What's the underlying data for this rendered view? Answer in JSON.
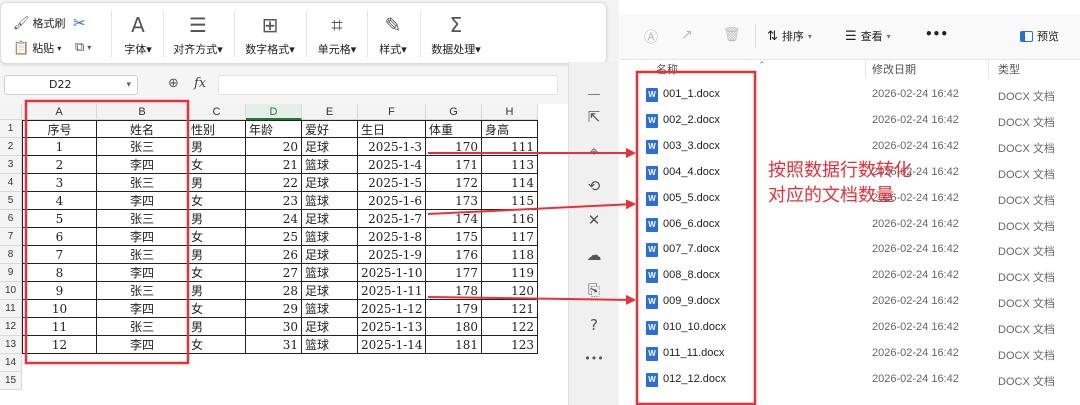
{
  "ribbon": {
    "format_painter": "格式刷",
    "paste": "粘贴",
    "font": "字体",
    "align": "对齐方式",
    "number_format": "数字格式",
    "cell": "单元格",
    "style": "样式",
    "data_process": "数据处理"
  },
  "formula_bar": {
    "name_box": "D22",
    "fx": "fx"
  },
  "sheet": {
    "columns": [
      "A",
      "B",
      "C",
      "D",
      "E",
      "F",
      "G",
      "H"
    ],
    "row_numbers": [
      "1",
      "2",
      "3",
      "4",
      "5",
      "6",
      "7",
      "8",
      "9",
      "10",
      "11",
      "12",
      "13",
      "14",
      "15"
    ],
    "headers": [
      "序号",
      "姓名",
      "性别",
      "年龄",
      "爱好",
      "生日",
      "体重",
      "身高"
    ],
    "rows": [
      [
        "1",
        "张三",
        "男",
        "20",
        "足球",
        "2025-1-3",
        "170",
        "111"
      ],
      [
        "2",
        "李四",
        "女",
        "21",
        "篮球",
        "2025-1-4",
        "171",
        "113"
      ],
      [
        "3",
        "张三",
        "男",
        "22",
        "足球",
        "2025-1-5",
        "172",
        "114"
      ],
      [
        "4",
        "李四",
        "女",
        "23",
        "篮球",
        "2025-1-6",
        "173",
        "115"
      ],
      [
        "5",
        "张三",
        "男",
        "24",
        "足球",
        "2025-1-7",
        "174",
        "116"
      ],
      [
        "6",
        "李四",
        "女",
        "25",
        "篮球",
        "2025-1-8",
        "175",
        "117"
      ],
      [
        "7",
        "张三",
        "男",
        "26",
        "足球",
        "2025-1-9",
        "176",
        "118"
      ],
      [
        "8",
        "李四",
        "女",
        "27",
        "篮球",
        "2025-1-10",
        "177",
        "119"
      ],
      [
        "9",
        "张三",
        "男",
        "28",
        "足球",
        "2025-1-11",
        "178",
        "120"
      ],
      [
        "10",
        "李四",
        "女",
        "29",
        "篮球",
        "2025-1-12",
        "179",
        "121"
      ],
      [
        "11",
        "张三",
        "男",
        "30",
        "足球",
        "2025-1-13",
        "180",
        "122"
      ],
      [
        "12",
        "李四",
        "女",
        "31",
        "篮球",
        "2025-1-14",
        "181",
        "123"
      ]
    ]
  },
  "explorer": {
    "toolbar": {
      "sort": "排序",
      "view": "查看",
      "more": "•••",
      "preview": "预览"
    },
    "columns": {
      "name": "名称",
      "modified": "修改日期",
      "type": "类型"
    },
    "files": [
      {
        "name": "001_1.docx",
        "date": "2026-02-24 16:42",
        "type": "DOCX 文档"
      },
      {
        "name": "002_2.docx",
        "date": "2026-02-24 16:42",
        "type": "DOCX 文档"
      },
      {
        "name": "003_3.docx",
        "date": "2026-02-24 16:42",
        "type": "DOCX 文档"
      },
      {
        "name": "004_4.docx",
        "date": "2026-02-24 16:42",
        "type": "DOCX 文档"
      },
      {
        "name": "005_5.docx",
        "date": "2026-02-24 16:42",
        "type": "DOCX 文档"
      },
      {
        "name": "006_6.docx",
        "date": "2026-02-24 16:42",
        "type": "DOCX 文档"
      },
      {
        "name": "007_7.docx",
        "date": "2026-02-24 16:42",
        "type": "DOCX 文档"
      },
      {
        "name": "008_8.docx",
        "date": "2026-02-24 16:42",
        "type": "DOCX 文档"
      },
      {
        "name": "009_9.docx",
        "date": "2026-02-24 16:42",
        "type": "DOCX 文档"
      },
      {
        "name": "010_10.docx",
        "date": "2026-02-24 16:42",
        "type": "DOCX 文档"
      },
      {
        "name": "011_11.docx",
        "date": "2026-02-24 16:42",
        "type": "DOCX 文档"
      },
      {
        "name": "012_12.docx",
        "date": "2026-02-24 16:42",
        "type": "DOCX 文档"
      }
    ]
  },
  "annotation": {
    "line1": "按照数据行数转化",
    "line2": "对应的文档数量",
    "color": "#e8303a"
  },
  "colors": {
    "highlight": "#e8303a",
    "selected_col": "#1f7a3a",
    "word_blue": "#2b6fd6"
  }
}
